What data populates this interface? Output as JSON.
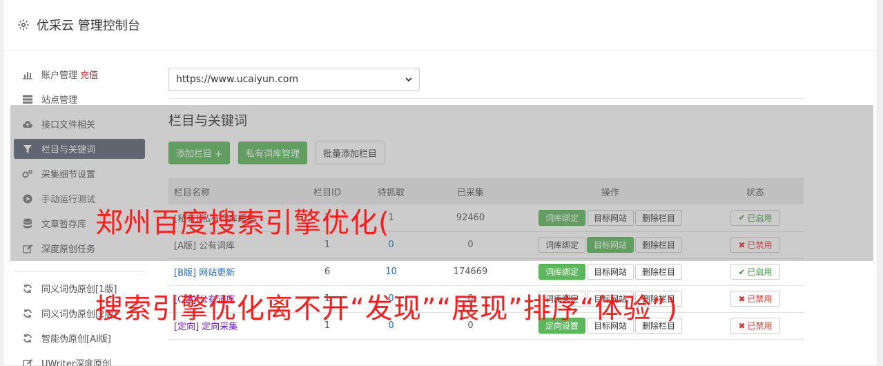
{
  "header": {
    "title": "优采云 管理控制台",
    "icon": "gear-icon"
  },
  "sidebar": {
    "items": [
      {
        "label": "账户管理",
        "extra": "充值",
        "icon": "bar-chart-icon"
      },
      {
        "label": "站点管理",
        "icon": "server-icon"
      },
      {
        "label": "接口文件相关",
        "icon": "cloud-upload-icon"
      },
      {
        "label": "栏目与关键词",
        "icon": "filter-icon",
        "active": true
      },
      {
        "label": "采集细节设置",
        "icon": "cogs-icon"
      },
      {
        "label": "手动运行测试",
        "icon": "play-circle-icon"
      },
      {
        "label": "文章暂存库",
        "icon": "database-icon"
      },
      {
        "label": "深度原创任务",
        "icon": "edit-icon"
      }
    ],
    "items2": [
      {
        "label": "同义词伪原创[1版]",
        "icon": "refresh-icon"
      },
      {
        "label": "同义词伪原创[2版]",
        "icon": "refresh-icon"
      },
      {
        "label": "智能伪原创[AI版]",
        "icon": "refresh-icon"
      },
      {
        "label": "UWriter深度原创",
        "icon": "edit-icon"
      }
    ]
  },
  "main": {
    "site_select": "https://www.ucaiyun.com",
    "section_title": "栏目与关键词",
    "toolbar": {
      "add_column": "添加栏目 +",
      "private_lexicon": "私有词库管理",
      "batch_add": "批量添加栏目"
    },
    "table": {
      "headers": [
        "栏目名称",
        "栏目ID",
        "待抓取",
        "已采集",
        "操作",
        "状态"
      ],
      "rows": [
        {
          "name": "[私有] 私有词库采集",
          "id": "1",
          "pending": "1",
          "collected": "92460",
          "b1": "词库绑定",
          "b2": "目标网站",
          "b3": "删除栏目",
          "status": "已启用",
          "on": true,
          "color": "normal",
          "b1g": true,
          "b2g": false
        },
        {
          "name": "[A版] 公有词库",
          "id": "1",
          "pending": "0",
          "collected": "0",
          "b1": "词库绑定",
          "b2": "目标网站",
          "b3": "删除栏目",
          "status": "已禁用",
          "on": false,
          "color": "normal",
          "b1g": false,
          "b2g": true
        },
        {
          "name": "[B版] 网站更新",
          "id": "6",
          "pending": "10",
          "collected": "174669",
          "b1": "词库绑定",
          "b2": "目标网站",
          "b3": "删除栏目",
          "status": "已启用",
          "on": true,
          "color": "blue",
          "b1g": true,
          "b2g": false
        },
        {
          "name": "[C版] 公有词库",
          "id": "1",
          "pending": "0",
          "collected": "0",
          "b1": "词库绑定",
          "b2": "目标网站",
          "b3": "删除栏目",
          "status": "已禁用",
          "on": false,
          "color": "purple",
          "b1g": false,
          "b2g": false
        },
        {
          "name": "[定向] 定向采集",
          "id": "1",
          "pending": "0",
          "collected": "0",
          "b1": "定向设置",
          "b2": "目标网站",
          "b3": "删除栏目",
          "status": "已禁用",
          "on": false,
          "color": "purple",
          "b1g": true,
          "b2g": false
        }
      ]
    }
  },
  "overlay": {
    "line1": "郑州百度搜索引擎优化(",
    "line2": "搜索引擎优化离不开“发现”“展现”排序“体验”)"
  },
  "colors": {
    "active_nav": "#5a6270",
    "green": "#5cb85c",
    "red_text": "#ff1a1a"
  }
}
